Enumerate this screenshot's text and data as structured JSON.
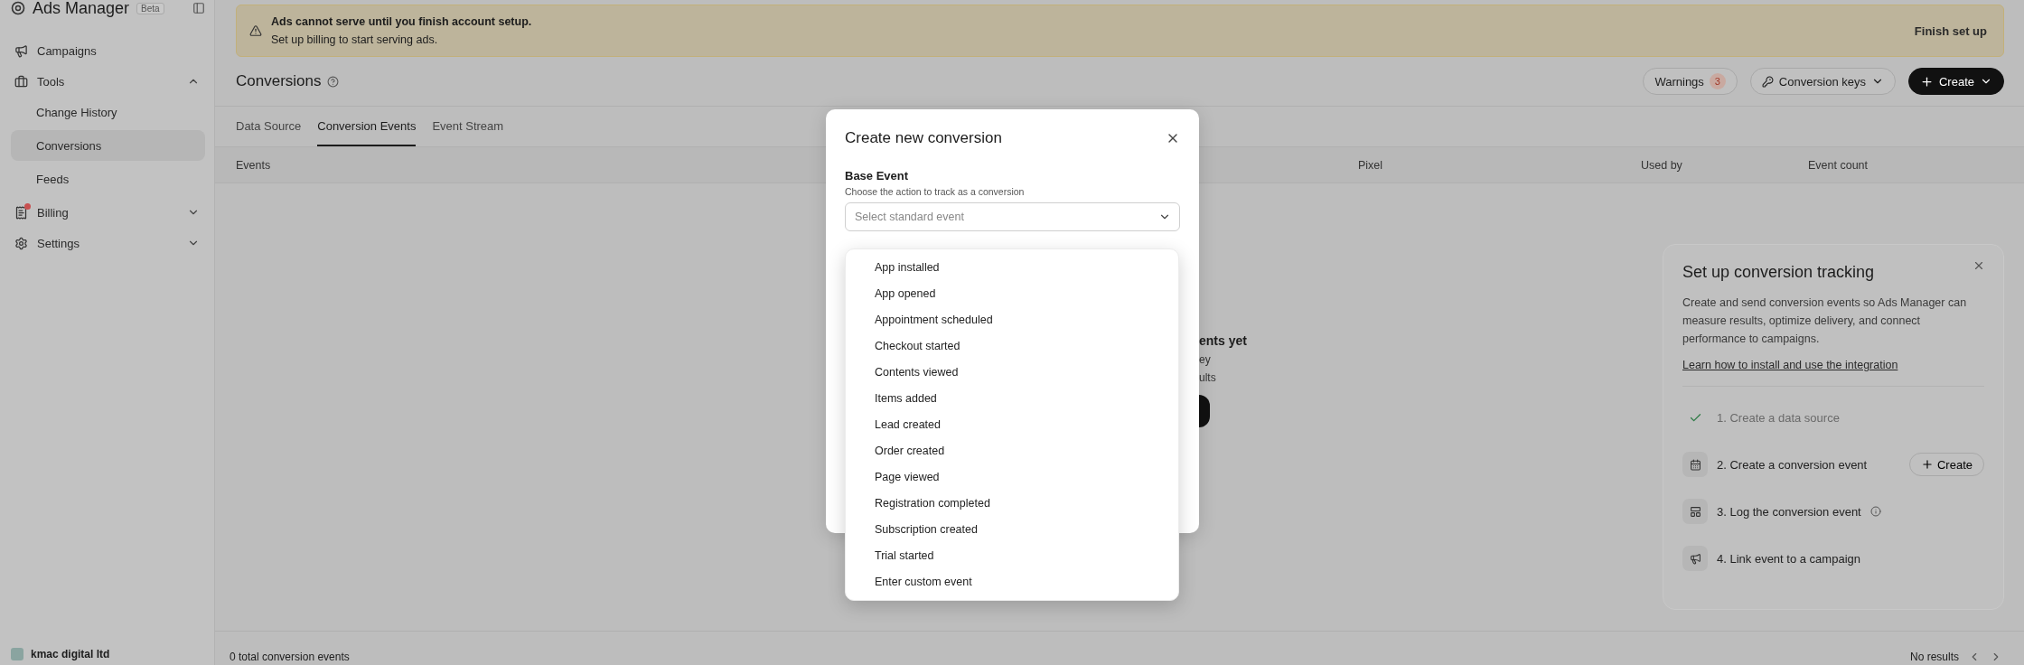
{
  "sidebar": {
    "brand": "Ads Manager",
    "badge": "Beta",
    "items": [
      {
        "label": "Campaigns",
        "alert": false
      },
      {
        "label": "Tools",
        "alert": false,
        "expanded": true,
        "children": [
          {
            "label": "Change History",
            "selected": false
          },
          {
            "label": "Conversions",
            "selected": true
          },
          {
            "label": "Feeds",
            "selected": false
          }
        ]
      },
      {
        "label": "Billing",
        "alert": true,
        "expanded": false
      },
      {
        "label": "Settings",
        "alert": false,
        "expanded": false
      }
    ],
    "account": "kmac digital ltd"
  },
  "banner": {
    "title": "Ads cannot serve until you finish account setup.",
    "text": "Set up billing to start serving ads.",
    "action": "Finish set up"
  },
  "header": {
    "title": "Conversions",
    "warnings": {
      "label": "Warnings",
      "count": "3"
    },
    "keys_button": "Conversion keys",
    "create_button": "Create"
  },
  "tabs": [
    {
      "label": "Data Source",
      "selected": false
    },
    {
      "label": "Conversion Events",
      "selected": true
    },
    {
      "label": "Event Stream",
      "selected": false
    }
  ],
  "table": {
    "columns": [
      "Events",
      "Pixel",
      "Used by",
      "Event count"
    ]
  },
  "empty_state": {
    "title": "ents yet",
    "lines": [
      "ey",
      "ults"
    ]
  },
  "modal": {
    "title": "Create new conversion",
    "field_label": "Base Event",
    "field_hint": "Choose the action to track as a conversion",
    "placeholder": "Select standard event",
    "options": [
      "App installed",
      "App opened",
      "Appointment scheduled",
      "Checkout started",
      "Contents viewed",
      "Items added",
      "Lead created",
      "Order created",
      "Page viewed",
      "Registration completed",
      "Subscription created",
      "Trial started",
      "Enter custom event"
    ]
  },
  "setup_panel": {
    "title": "Set up conversion tracking",
    "description": "Create and send conversion events so Ads Manager can measure results, optimize delivery, and connect performance to campaigns.",
    "link": "Learn how to install and use the integration",
    "steps": [
      {
        "label": "1. Create a data source",
        "done": true
      },
      {
        "label": "2. Create a conversion event",
        "done": false,
        "action": "Create"
      },
      {
        "label": "3. Log the conversion event",
        "done": false,
        "info": true
      },
      {
        "label": "4. Link event to a campaign",
        "done": false
      }
    ]
  },
  "status_bar": {
    "count": "0 total conversion events",
    "pagination": "No results"
  }
}
